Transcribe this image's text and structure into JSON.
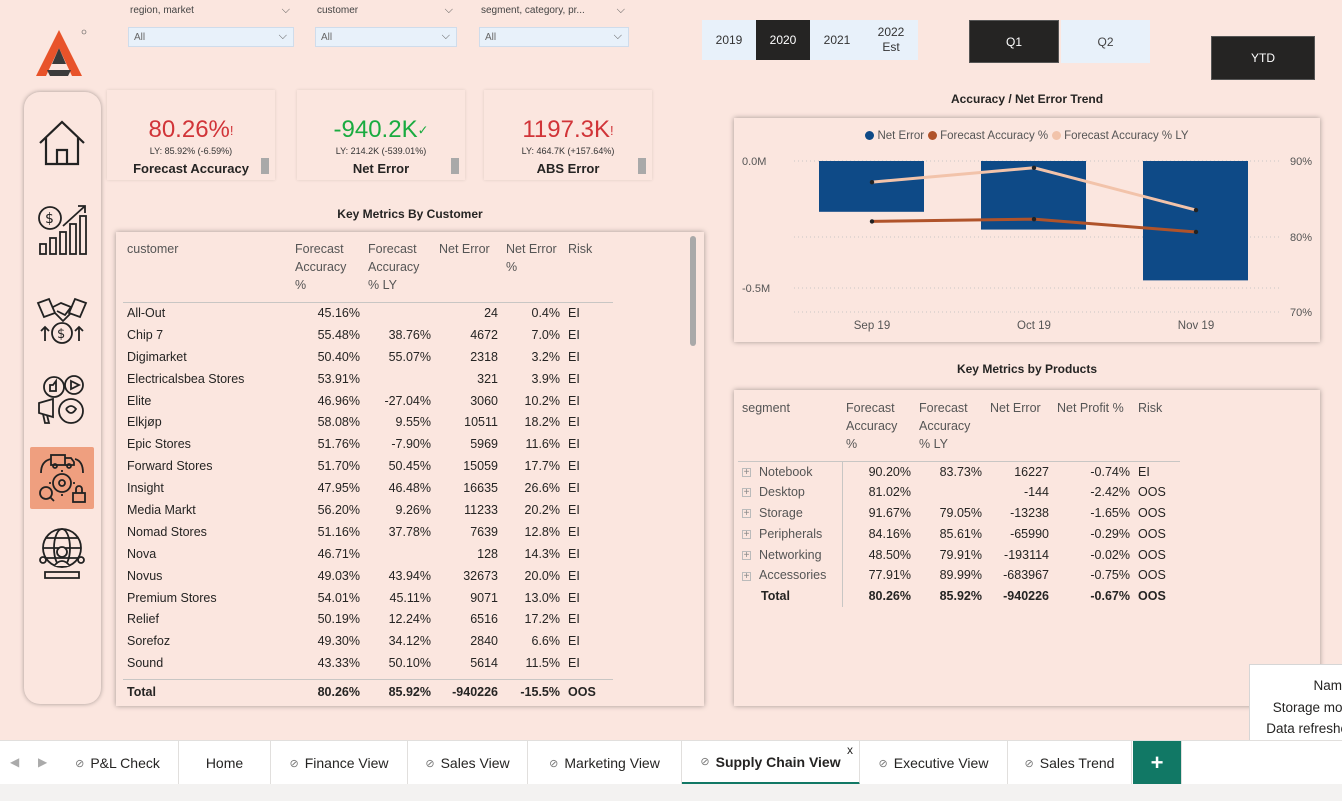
{
  "filters": [
    {
      "label": "region, market",
      "value": "All"
    },
    {
      "label": "customer",
      "value": "All"
    },
    {
      "label": "segment, category, pr...",
      "value": "All"
    }
  ],
  "years": [
    {
      "label": "2019",
      "selected": false
    },
    {
      "label": "2020",
      "selected": true
    },
    {
      "label": "2021",
      "selected": false
    },
    {
      "label": "2022 Est",
      "selected": false
    }
  ],
  "quarters": {
    "q1": "Q1",
    "q2": "Q2",
    "ytd": "YTD"
  },
  "nav_icons": [
    "home-icon",
    "finance-growth-icon",
    "sales-handshake-icon",
    "marketing-icon",
    "supply-chain-icon",
    "executive-globe-icon"
  ],
  "cards": [
    {
      "value": "80.26%",
      "mark": "!",
      "ly": "LY: 85.92% (-6.59%)",
      "label": "Forecast Accuracy",
      "color": "#d13438"
    },
    {
      "value": "-940.2K",
      "mark": "✓",
      "ly": "LY: 214.2K (-539.01%)",
      "label": "Net Error",
      "color": "#1aab40"
    },
    {
      "value": "1197.3K",
      "mark": "!",
      "ly": "LY: 464.7K (+157.64%)",
      "label": "ABS Error",
      "color": "#d13438"
    }
  ],
  "customer_table": {
    "title": "Key Metrics By Customer",
    "headers": [
      "customer",
      "Forecast Accuracy %",
      "Forecast Accuracy % LY",
      "Net Error",
      "Net Error %",
      "Risk"
    ],
    "rows": [
      [
        "All-Out",
        "45.16%",
        "",
        "24",
        "0.4%",
        "EI"
      ],
      [
        "Chip 7",
        "55.48%",
        "38.76%",
        "4672",
        "7.0%",
        "EI"
      ],
      [
        "Digimarket",
        "50.40%",
        "55.07%",
        "2318",
        "3.2%",
        "EI"
      ],
      [
        "Electricalsbea Stores",
        "53.91%",
        "",
        "321",
        "3.9%",
        "EI"
      ],
      [
        "Elite",
        "46.96%",
        "-27.04%",
        "3060",
        "10.2%",
        "EI"
      ],
      [
        "Elkjøp",
        "58.08%",
        "9.55%",
        "10511",
        "18.2%",
        "EI"
      ],
      [
        "Epic Stores",
        "51.76%",
        "-7.90%",
        "5969",
        "11.6%",
        "EI"
      ],
      [
        "Forward Stores",
        "51.70%",
        "50.45%",
        "15059",
        "17.7%",
        "EI"
      ],
      [
        "Insight",
        "47.95%",
        "46.48%",
        "16635",
        "26.6%",
        "EI"
      ],
      [
        "Media Markt",
        "56.20%",
        "9.26%",
        "11233",
        "20.2%",
        "EI"
      ],
      [
        "Nomad Stores",
        "51.16%",
        "37.78%",
        "7639",
        "12.8%",
        "EI"
      ],
      [
        "Nova",
        "46.71%",
        "",
        "128",
        "14.3%",
        "EI"
      ],
      [
        "Novus",
        "49.03%",
        "43.94%",
        "32673",
        "20.0%",
        "EI"
      ],
      [
        "Premium Stores",
        "54.01%",
        "45.11%",
        "9071",
        "13.0%",
        "EI"
      ],
      [
        "Relief",
        "50.19%",
        "12.24%",
        "6516",
        "17.2%",
        "EI"
      ],
      [
        "Sorefoz",
        "49.30%",
        "34.12%",
        "2840",
        "6.6%",
        "EI"
      ],
      [
        "Sound",
        "43.33%",
        "50.10%",
        "5614",
        "11.5%",
        "EI"
      ]
    ],
    "total": [
      "Total",
      "80.26%",
      "85.92%",
      "-940226",
      "-15.5%",
      "OOS"
    ]
  },
  "chart_data": {
    "type": "bar",
    "title": "Accuracy / Net Error Trend",
    "categories": [
      "Sep 19",
      "Oct 19",
      "Nov 19"
    ],
    "series": [
      {
        "name": "Net Error",
        "kind": "bar",
        "axis": "left",
        "values": [
          -0.2,
          -0.27,
          -0.47
        ],
        "color": "#0e4a87"
      },
      {
        "name": "Forecast Accuracy %",
        "kind": "line",
        "axis": "right",
        "values": [
          82.0,
          82.3,
          80.6
        ],
        "color": "#b0532a"
      },
      {
        "name": "Forecast Accuracy % LY",
        "kind": "line",
        "axis": "right",
        "values": [
          87.2,
          89.1,
          83.5
        ],
        "color": "#f2c3aa"
      }
    ],
    "left_axis": {
      "ticks": [
        "0.0M",
        "-0.5M"
      ],
      "range_M": [
        -0.5,
        0
      ]
    },
    "right_axis": {
      "ticks": [
        "90%",
        "80%",
        "70%"
      ],
      "range": [
        70,
        90
      ]
    },
    "legend_position": "top-center"
  },
  "product_table": {
    "title": "Key Metrics by Products",
    "headers": [
      "segment",
      "Forecast Accuracy %",
      "Forecast Accuracy % LY",
      "Net Error",
      "Net Profit %",
      "Risk"
    ],
    "rows": [
      [
        "Notebook",
        "90.20%",
        "83.73%",
        "16227",
        "-0.74%",
        "EI"
      ],
      [
        "Desktop",
        "81.02%",
        "",
        "-144",
        "-2.42%",
        "OOS"
      ],
      [
        "Storage",
        "91.67%",
        "79.05%",
        "-13238",
        "-1.65%",
        "OOS"
      ],
      [
        "Peripherals",
        "84.16%",
        "85.61%",
        "-65990",
        "-0.29%",
        "OOS"
      ],
      [
        "Networking",
        "48.50%",
        "79.91%",
        "-193114",
        "-0.02%",
        "OOS"
      ],
      [
        "Accessories",
        "77.91%",
        "89.99%",
        "-683967",
        "-0.75%",
        "OOS"
      ]
    ],
    "total": [
      "Total",
      "80.26%",
      "85.92%",
      "-940226",
      "-0.67%",
      "OOS"
    ]
  },
  "tooltip_lines": [
    "Nam",
    "Storage mod",
    "Data refreshe"
  ],
  "tabs": [
    {
      "label": "P&L Check",
      "hidden": true
    },
    {
      "label": "Home",
      "hidden": false
    },
    {
      "label": "Finance View",
      "hidden": true
    },
    {
      "label": "Sales View",
      "hidden": true
    },
    {
      "label": "Marketing View",
      "hidden": true
    },
    {
      "label": "Supply Chain View",
      "hidden": true,
      "active": true
    },
    {
      "label": "Executive View",
      "hidden": true
    },
    {
      "label": "Sales Trend",
      "hidden": true
    }
  ],
  "tab_close": "x",
  "add_tab": "+",
  "colors": {
    "accent": "#117865",
    "selected_dark": "#252423",
    "nav_selected": "#ef9f7f",
    "slicer_bg": "#e8f1fa"
  }
}
